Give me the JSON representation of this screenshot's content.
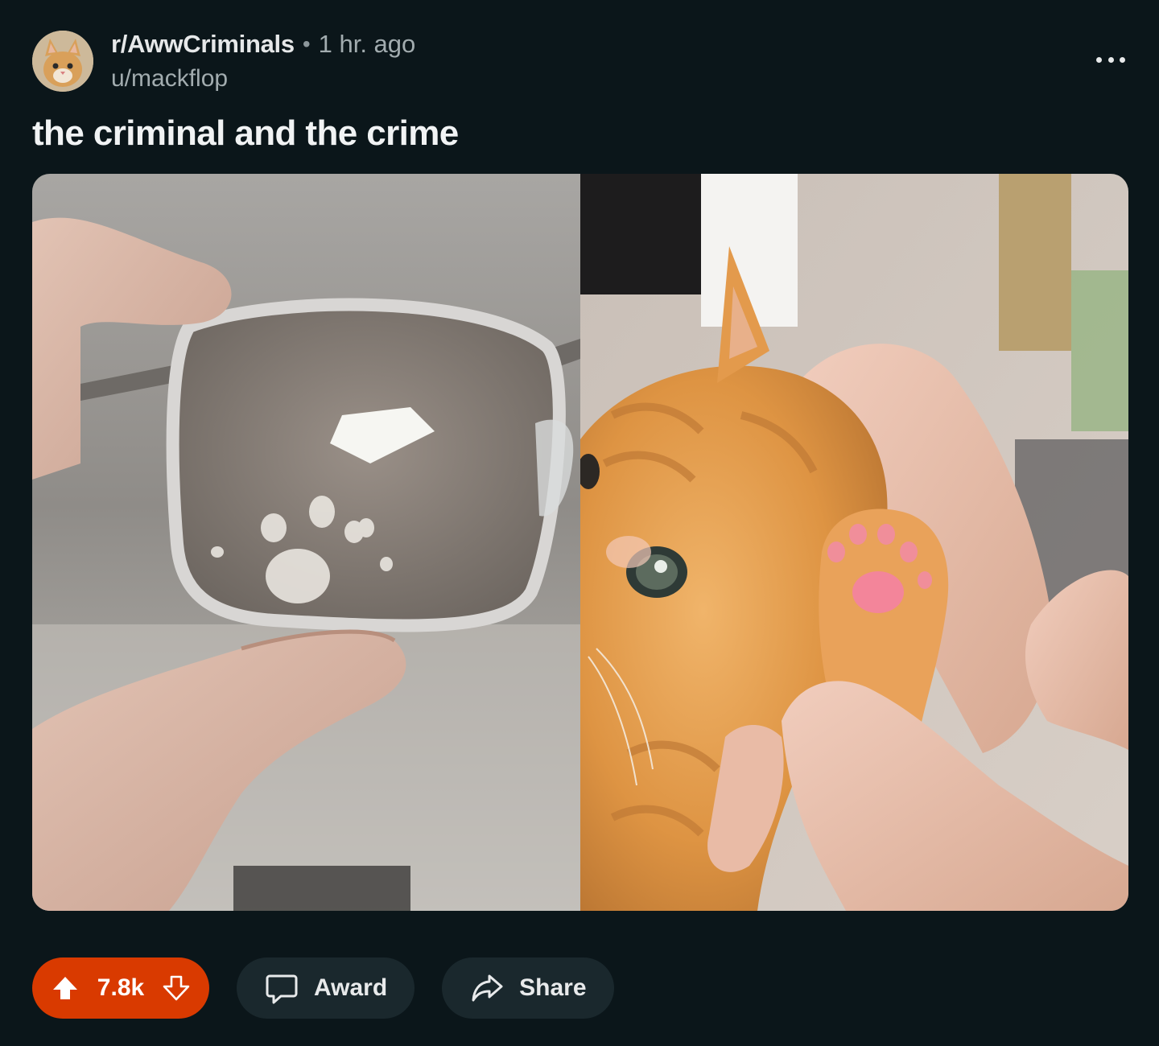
{
  "post": {
    "subreddit": "r/AwwCriminals",
    "separator": "•",
    "time_ago": "1 hr. ago",
    "username": "u/mackflop",
    "title": "the criminal and the crime"
  },
  "gallery": {
    "images": [
      {
        "name": "glasses-with-paw-print",
        "icon": "photo"
      },
      {
        "name": "orange-kitten-paw",
        "icon": "photo"
      }
    ]
  },
  "actions": {
    "vote_count": "7.8k",
    "award_label": "Award",
    "share_label": "Share"
  },
  "colors": {
    "background": "#0b161a",
    "upvoted_accent": "#d93a00",
    "pill_background": "#1a282d"
  }
}
